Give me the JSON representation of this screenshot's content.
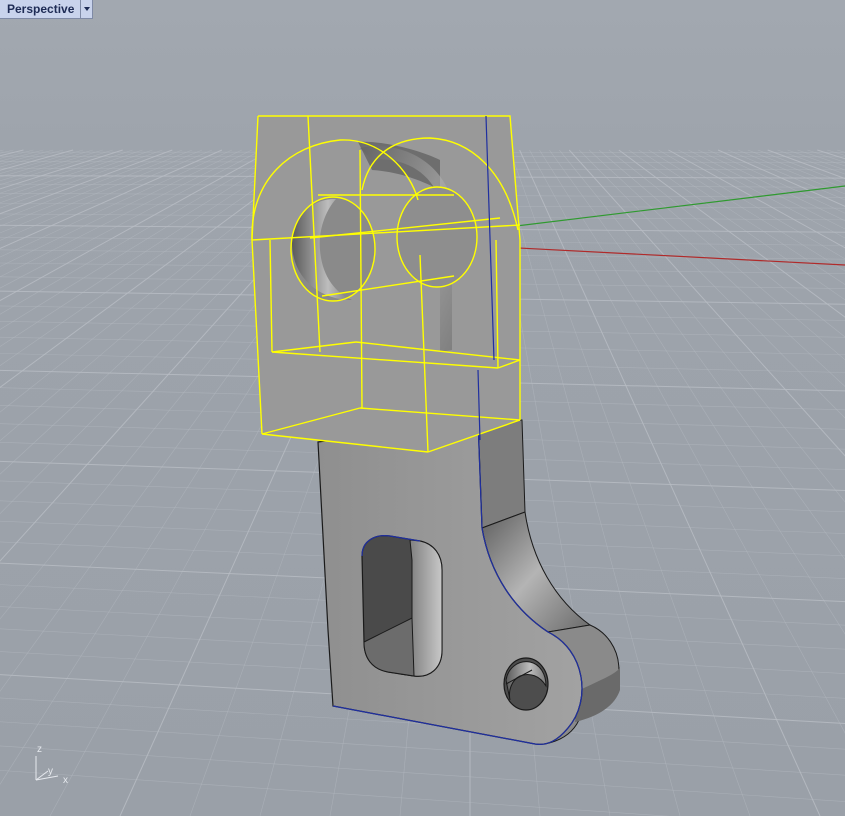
{
  "viewport": {
    "title": "Perspective",
    "background_color": "#9ea4ac",
    "grid_color": "#b7bcc3",
    "selection_color": "#ffff00",
    "x_axis_color": "#b02a2a",
    "y_axis_color": "#2f9a2f",
    "edge_color": "#1f2fa0",
    "dropdown_icon": "chevron-down-icon"
  },
  "axis_triad": {
    "z_label": "z",
    "y_label": "y",
    "x_label": "x"
  }
}
